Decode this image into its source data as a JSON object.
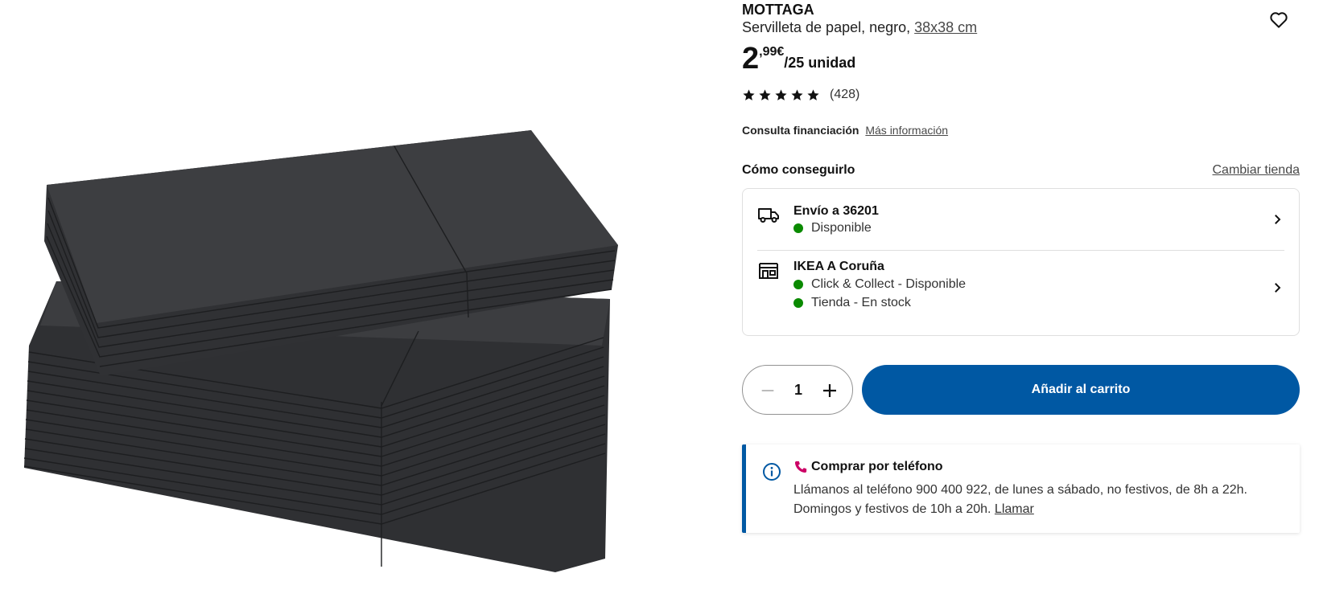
{
  "product": {
    "name": "MOTTAGA",
    "description": "Servilleta de papel, negro, ",
    "size_link": "38x38 cm",
    "image_alt": "Servilletas de papel negras MOTTAGA"
  },
  "price": {
    "integer": "2",
    "decimals": ",99€",
    "unit": "/25 unidad"
  },
  "rating": {
    "stars": 5,
    "count": "(428)"
  },
  "finance": {
    "label": "Consulta financiación",
    "link": "Más información"
  },
  "availability": {
    "title": "Cómo conseguirlo",
    "change_store": "Cambiar tienda",
    "delivery": {
      "title": "Envío a 36201",
      "status": "Disponible"
    },
    "store": {
      "title": "IKEA A Coruña",
      "status_collect": "Click & Collect - Disponible",
      "status_stock": "Tienda - En stock"
    }
  },
  "quantity": {
    "value": "1"
  },
  "cart": {
    "add_label": "Añadir al carrito"
  },
  "phone": {
    "title": "Comprar por teléfono",
    "text": "Llámanos al teléfono 900 400 922, de lunes a sábado, no festivos, de 8h a 22h. Domingos y festivos de 10h a 20h. ",
    "link": "Llamar"
  },
  "colors": {
    "brand_blue": "#0058a3",
    "available_green": "#0a8a00",
    "phone_pink": "#cc0066",
    "napkin": "#3a3b3e"
  },
  "icons": [
    "heart-icon",
    "star-icon",
    "truck-icon",
    "store-icon",
    "chevron-right-icon",
    "minus-icon",
    "plus-icon",
    "info-icon",
    "phone-icon"
  ]
}
